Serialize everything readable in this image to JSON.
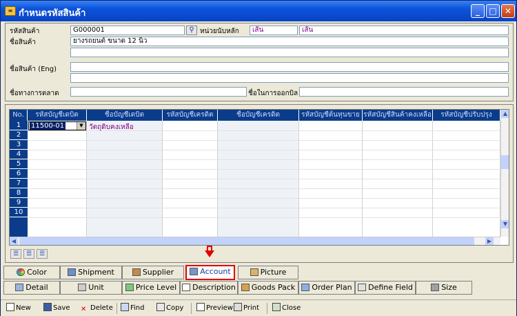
{
  "window": {
    "title": "กำหนดรหัสสินค้า",
    "app_icon": "app-icon"
  },
  "form": {
    "product_code_label": "รหัสสินค้า",
    "product_code": "G000001",
    "unit_label": "หน่วยนับหลัก",
    "unit_code": "เส้น",
    "unit_name": "เส้น",
    "product_name_label": "ชื่อสินค้า",
    "product_name": "ยางรถยนต์ ขนาด 12 นิ้ว",
    "product_name_eng_label": "ชื่อสินค้า (Eng)",
    "market_name_label": "ชื่อทางการตลาด",
    "invoice_name_label": "ชื่อในการออกบิล"
  },
  "grid": {
    "columns": [
      "No.",
      "รหัสบัญชีเดบิต",
      "ชื่อบัญชีเดบิต",
      "รหัสบัญชีเครดิต",
      "ชื่อบัญชีเครดิต",
      "รหัสบัญชีต้นทุนขาย",
      "รหัสบัญชีสินค้าคงเหลือ",
      "รหัสบัญชีปรับปรุง"
    ],
    "row_numbers": [
      "1",
      "2",
      "3",
      "4",
      "5",
      "6",
      "7",
      "8",
      "9",
      "10"
    ],
    "rows": [
      {
        "debit_code": "11500-01",
        "debit_name": "วัตถุดิบคงเหลือ"
      }
    ]
  },
  "tabs_row1": [
    {
      "label": "Color",
      "icon": "color-wheel-icon"
    },
    {
      "label": "Shipment",
      "icon": "shipment-icon"
    },
    {
      "label": "Supplier",
      "icon": "supplier-icon"
    },
    {
      "label": "Account",
      "icon": "account-icon",
      "active": true
    },
    {
      "label": "Picture",
      "icon": "picture-icon"
    }
  ],
  "tabs_row2": [
    {
      "label": "Detail",
      "icon": "detail-icon"
    },
    {
      "label": "Unit",
      "icon": "unit-icon"
    },
    {
      "label": "Price Level",
      "icon": "price-level-icon"
    },
    {
      "label": "Description",
      "icon": "description-icon"
    },
    {
      "label": "Goods Pack",
      "icon": "goods-pack-icon"
    },
    {
      "label": "Order Plan",
      "icon": "order-plan-icon"
    },
    {
      "label": "Define Field",
      "icon": "define-field-icon"
    },
    {
      "label": "Size",
      "icon": "size-icon"
    }
  ],
  "toolbar": {
    "new": "New",
    "save": "Save",
    "delete": "Delete",
    "find": "Find",
    "copy": "Copy",
    "preview": "Preview",
    "print": "Print",
    "close": "Close"
  },
  "colors": {
    "accent": "#0a3c8a",
    "highlight": "#e00000",
    "purple_text": "#800080"
  }
}
